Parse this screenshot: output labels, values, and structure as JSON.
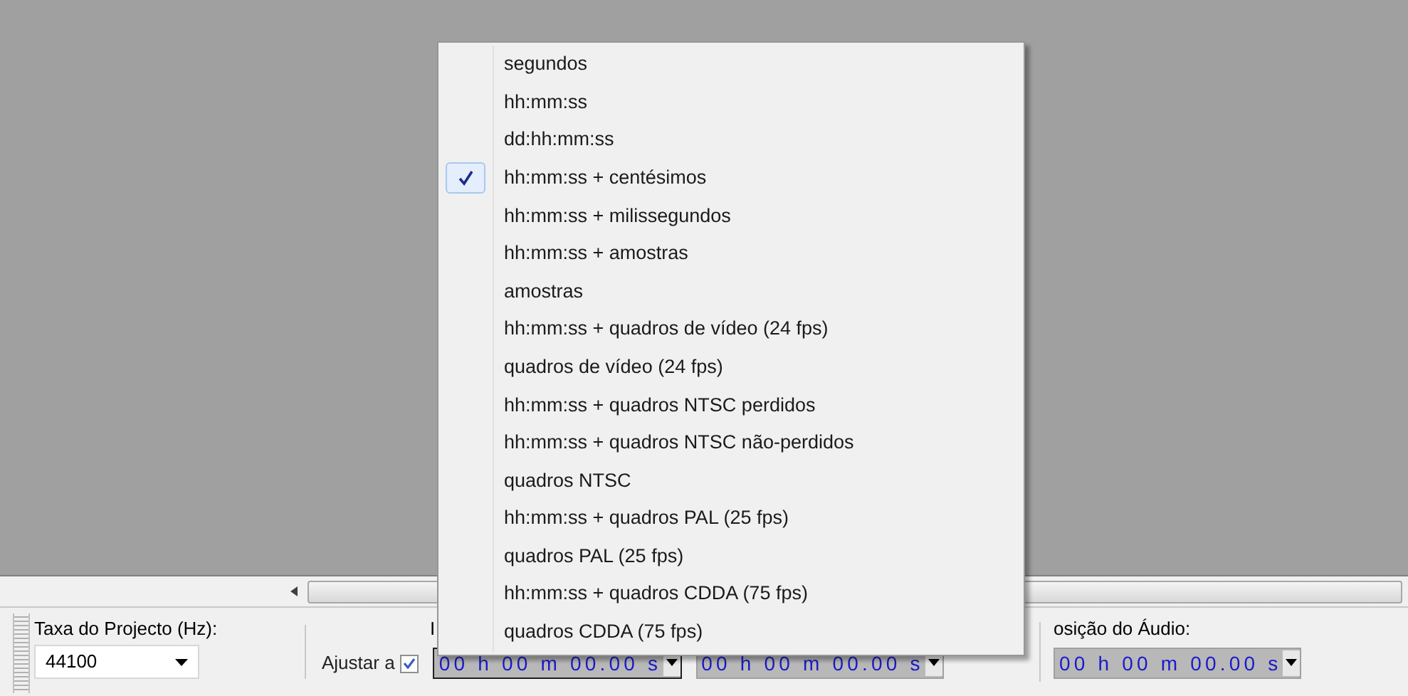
{
  "toolbar": {
    "rate_label": "Taxa do Projecto (Hz):",
    "rate_value": "44100",
    "snap_label": "Ajustar a",
    "snap_checked": true,
    "hidden_label": "I",
    "audio_position_label": "osição do Áudio:",
    "time_fields": [
      {
        "value": "00 h 00 m 00.00 s",
        "focused": true
      },
      {
        "value": "00 h 00 m 00.00 s",
        "focused": false
      },
      {
        "value": "00 h 00 m 00.00 s",
        "focused": false
      }
    ]
  },
  "menu": {
    "items": [
      {
        "label": "segundos",
        "selected": false
      },
      {
        "label": "hh:mm:ss",
        "selected": false
      },
      {
        "label": "dd:hh:mm:ss",
        "selected": false
      },
      {
        "label": "hh:mm:ss + centésimos",
        "selected": true
      },
      {
        "label": "hh:mm:ss + milissegundos",
        "selected": false
      },
      {
        "label": "hh:mm:ss + amostras",
        "selected": false
      },
      {
        "label": "amostras",
        "selected": false
      },
      {
        "label": "hh:mm:ss + quadros de vídeo (24 fps)",
        "selected": false
      },
      {
        "label": "quadros de vídeo (24 fps)",
        "selected": false
      },
      {
        "label": "hh:mm:ss + quadros NTSC perdidos",
        "selected": false
      },
      {
        "label": "hh:mm:ss + quadros NTSC não-perdidos",
        "selected": false
      },
      {
        "label": "quadros NTSC",
        "selected": false
      },
      {
        "label": "hh:mm:ss + quadros PAL (25 fps)",
        "selected": false
      },
      {
        "label": "quadros PAL (25 fps)",
        "selected": false
      },
      {
        "label": "hh:mm:ss + quadros CDDA (75 fps)",
        "selected": false
      },
      {
        "label": "quadros CDDA (75 fps)",
        "selected": false
      }
    ]
  }
}
